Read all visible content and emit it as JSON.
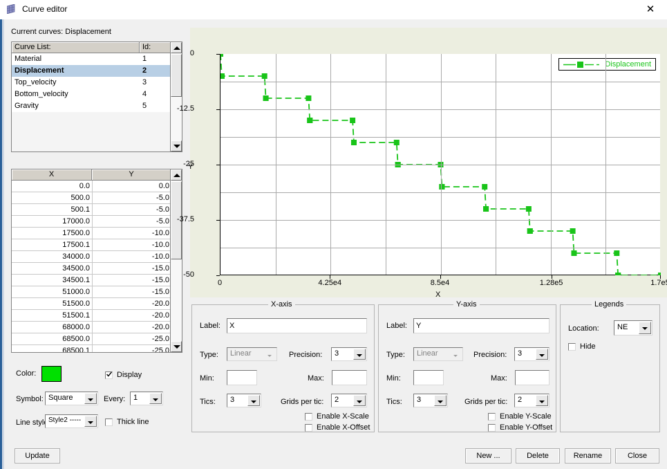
{
  "window": {
    "title": "Curve editor",
    "close_label": "✕"
  },
  "current_curves": {
    "label": "Current curves:",
    "value": "Displacement"
  },
  "curve_list": {
    "header_name": "Curve List:",
    "header_id": "Id:",
    "items": [
      {
        "name": "Material",
        "id": "1",
        "selected": false
      },
      {
        "name": "Displacement",
        "id": "2",
        "selected": true
      },
      {
        "name": "Top_velocity",
        "id": "3",
        "selected": false
      },
      {
        "name": "Bottom_velocity",
        "id": "4",
        "selected": false
      },
      {
        "name": "Gravity",
        "id": "5",
        "selected": false
      }
    ]
  },
  "data_table": {
    "col_x": "X",
    "col_y": "Y",
    "rows": [
      {
        "x": "0.0",
        "y": "0.0"
      },
      {
        "x": "500.0",
        "y": "-5.0"
      },
      {
        "x": "500.1",
        "y": "-5.0"
      },
      {
        "x": "17000.0",
        "y": "-5.0"
      },
      {
        "x": "17500.0",
        "y": "-10.0"
      },
      {
        "x": "17500.1",
        "y": "-10.0"
      },
      {
        "x": "34000.0",
        "y": "-10.0"
      },
      {
        "x": "34500.0",
        "y": "-15.0"
      },
      {
        "x": "34500.1",
        "y": "-15.0"
      },
      {
        "x": "51000.0",
        "y": "-15.0"
      },
      {
        "x": "51500.0",
        "y": "-20.0"
      },
      {
        "x": "51500.1",
        "y": "-20.0"
      },
      {
        "x": "68000.0",
        "y": "-20.0"
      },
      {
        "x": "68500.0",
        "y": "-25.0"
      },
      {
        "x": "68500.1",
        "y": "-25.0"
      }
    ]
  },
  "style_panel": {
    "color_label": "Color:",
    "color_value": "#00e000",
    "display_label": "Display",
    "display_checked": true,
    "symbol_label": "Symbol:",
    "symbol_value": "Square",
    "every_label": "Every:",
    "every_value": "1",
    "line_style_label": "Line style:",
    "line_style_value": "Style2 -----",
    "thick_line_label": "Thick line",
    "thick_line_checked": false
  },
  "x_axis": {
    "group_title": "X-axis",
    "label_label": "Label:",
    "label_value": "X",
    "type_label": "Type:",
    "type_value": "Linear",
    "precision_label": "Precision:",
    "precision_value": "3",
    "min_label": "Min:",
    "min_value": "",
    "max_label": "Max:",
    "max_value": "",
    "tics_label": "Tics:",
    "tics_value": "3",
    "grids_label": "Grids per tic:",
    "grids_value": "2",
    "enable_scale_label": "Enable X-Scale",
    "enable_scale_checked": false,
    "enable_offset_label": "Enable X-Offset",
    "enable_offset_checked": false
  },
  "y_axis": {
    "group_title": "Y-axis",
    "label_label": "Label:",
    "label_value": "Y",
    "type_label": "Type:",
    "type_value": "Linear",
    "precision_label": "Precision:",
    "precision_value": "3",
    "min_label": "Min:",
    "min_value": "",
    "max_label": "Max:",
    "max_value": "",
    "tics_label": "Tics:",
    "tics_value": "3",
    "grids_label": "Grids per tic:",
    "grids_value": "2",
    "enable_scale_label": "Enable Y-Scale",
    "enable_scale_checked": false,
    "enable_offset_label": "Enable Y-Offset",
    "enable_offset_checked": false
  },
  "legends": {
    "group_title": "Legends",
    "location_label": "Location:",
    "location_value": "NE",
    "hide_label": "Hide",
    "hide_checked": false
  },
  "buttons": {
    "update": "Update",
    "new": "New ...",
    "delete": "Delete",
    "rename": "Rename",
    "close": "Close"
  },
  "chart_data": {
    "type": "line",
    "title": "",
    "xlabel": "X",
    "ylabel": "Y",
    "series": [
      {
        "name": "Displacement",
        "color": "#19c419",
        "marker": "square",
        "linestyle": "dashed",
        "x": [
          0,
          500,
          500.1,
          17000,
          17500,
          17500.1,
          34000,
          34500,
          34500.1,
          51000,
          51500,
          51500.1,
          68000,
          68500,
          68500.1,
          85000,
          85500,
          85500.1,
          102000,
          102500,
          102500.1,
          119000,
          119500,
          119500.1,
          136000,
          136500,
          136500.1,
          153000,
          153500,
          153500.1,
          170000
        ],
        "y": [
          0,
          -5,
          -5,
          -5,
          -10,
          -10,
          -10,
          -15,
          -15,
          -15,
          -20,
          -20,
          -20,
          -25,
          -25,
          -25,
          -30,
          -30,
          -30,
          -35,
          -35,
          -35,
          -40,
          -40,
          -40,
          -45,
          -45,
          -45,
          -50,
          -50,
          -50
        ]
      }
    ],
    "xlim": [
      0,
      170000
    ],
    "ylim": [
      -50,
      0
    ],
    "xticks": [
      0,
      42500,
      85000,
      128000,
      170000
    ],
    "xtick_labels": [
      "0",
      "4.25e4",
      "8.5e4",
      "1.28e5",
      "1.7e5"
    ],
    "yticks": [
      0,
      -12.5,
      -25,
      -37.5,
      -50
    ],
    "ytick_labels": [
      "0",
      "-12.5",
      "-25",
      "-37.5",
      "-50"
    ],
    "grid": true,
    "grids_per_tic": 2,
    "legend_position": "NE",
    "legend_entries": [
      "Displacement"
    ]
  }
}
